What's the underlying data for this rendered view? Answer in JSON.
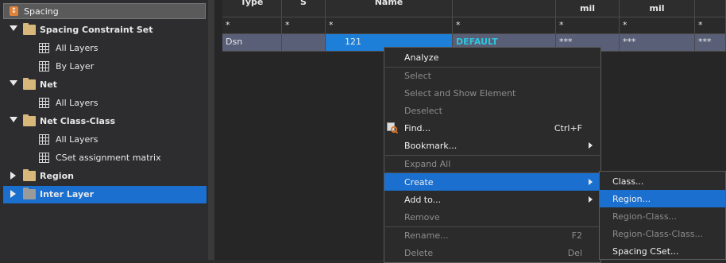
{
  "tree": {
    "header": "Spacing",
    "items": [
      {
        "label": "Spacing Constraint Set",
        "kind": "folder",
        "expanded": true
      },
      {
        "label": "All Layers",
        "kind": "sheet"
      },
      {
        "label": "By Layer",
        "kind": "sheet"
      },
      {
        "label": "Net",
        "kind": "folder",
        "expanded": true
      },
      {
        "label": "All Layers",
        "kind": "sheet"
      },
      {
        "label": "Net Class-Class",
        "kind": "folder",
        "expanded": true
      },
      {
        "label": "All Layers",
        "kind": "sheet"
      },
      {
        "label": "CSet assignment matrix",
        "kind": "sheet"
      },
      {
        "label": "Region",
        "kind": "folder",
        "expanded": false
      },
      {
        "label": "Inter Layer",
        "kind": "folder",
        "expanded": false,
        "selected": true
      }
    ]
  },
  "sheet": {
    "headers": [
      "Type",
      "S",
      "Name",
      "",
      "mil",
      "mil",
      ""
    ],
    "filters": [
      "*",
      "*",
      "*",
      "*",
      "*",
      "*",
      "*"
    ],
    "row": [
      "Dsn",
      "",
      "121",
      "DEFAULT",
      "***",
      "***",
      "***"
    ]
  },
  "context_menu": {
    "items": [
      {
        "label": "Analyze",
        "state": "enabled"
      },
      {
        "label": "Select",
        "state": "disabled"
      },
      {
        "label": "Select and Show Element",
        "state": "disabled"
      },
      {
        "label": "Deselect",
        "state": "disabled"
      },
      {
        "label": "Find...",
        "state": "enabled",
        "shortcut": "Ctrl+F",
        "icon": "find-icon"
      },
      {
        "label": "Bookmark...",
        "state": "enabled",
        "submenu": true
      },
      {
        "label": "Expand All",
        "state": "disabled"
      },
      {
        "label": "Create",
        "state": "highlighted",
        "submenu": true
      },
      {
        "label": "Add to...",
        "state": "enabled",
        "submenu": true
      },
      {
        "label": "Remove",
        "state": "disabled"
      },
      {
        "label": "Rename...",
        "state": "disabled",
        "shortcut": "F2"
      },
      {
        "label": "Delete",
        "state": "disabled",
        "shortcut": "Del"
      }
    ]
  },
  "submenu": {
    "items": [
      {
        "label": "Class...",
        "state": "enabled"
      },
      {
        "label": "Region...",
        "state": "highlighted"
      },
      {
        "label": "Region-Class...",
        "state": "disabled"
      },
      {
        "label": "Region-Class-Class...",
        "state": "disabled"
      },
      {
        "label": "Spacing CSet...",
        "state": "enabled"
      }
    ]
  },
  "colors": {
    "selection": "#1a6fcf",
    "default_text": "#2ec7e0",
    "row_bg": "#5a5f78"
  }
}
